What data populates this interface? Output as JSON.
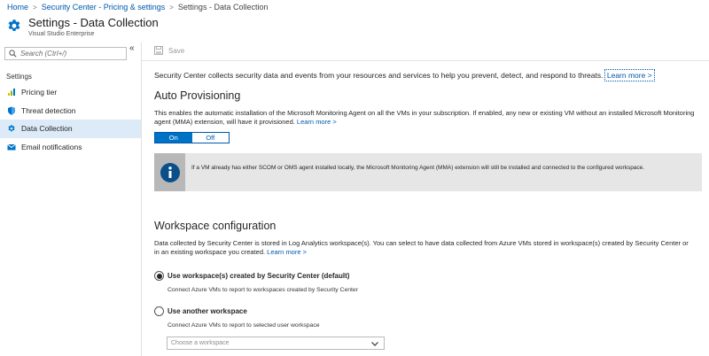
{
  "breadcrumb": {
    "items": [
      "Home",
      "Security Center - Pricing & settings",
      "Settings - Data Collection"
    ]
  },
  "header": {
    "title": "Settings - Data Collection",
    "subtitle": "Visual Studio Enterprise",
    "icon": "gear-icon",
    "icon_color": "#0072c6"
  },
  "sidebar": {
    "collapse_label": "«",
    "search": {
      "placeholder": "Search (Ctrl+/)",
      "value": ""
    },
    "section_label": "Settings",
    "items": [
      {
        "label": "Pricing tier",
        "icon": "pricing-tier-icon",
        "active": false
      },
      {
        "label": "Threat detection",
        "icon": "shield-icon",
        "active": false
      },
      {
        "label": "Data Collection",
        "icon": "gear-icon",
        "active": true
      },
      {
        "label": "Email notifications",
        "icon": "email-icon",
        "active": false
      }
    ]
  },
  "toolbar": {
    "save_label": "Save",
    "save_enabled": false
  },
  "intro": {
    "text": "Security Center collects security data and events from your resources and services to help you prevent, detect, and respond to threats.",
    "link": "Learn more >"
  },
  "auto_provisioning": {
    "title": "Auto Provisioning",
    "description": "This enables the automatic installation of the Microsoft Monitoring Agent on all the VMs in your subscription. If enabled, any new or existing VM without an installed Microsoft Monitoring agent (MMA) extension, will have it provisioned.",
    "link": "Learn more >",
    "toggle": {
      "on_label": "On",
      "off_label": "Off",
      "selected": "On"
    },
    "info_text": "If a VM already has either SCOM or OMS agent installed locally, the Microsoft Monitoring Agent (MMA) extension will still be installed and connected to the configured workspace."
  },
  "workspace": {
    "title": "Workspace configuration",
    "description": "Data collected by Security Center is stored in Log Analytics workspace(s). You can select to have data collected from Azure VMs stored in workspace(s) created by Security Center or in an existing workspace you created.",
    "link": "Learn more >",
    "options": [
      {
        "label": "Use workspace(s) created by Security Center (default)",
        "description": "Connect Azure VMs to report to workspaces created by Security Center",
        "selected": true
      },
      {
        "label": "Use another workspace",
        "description": "Connect Azure VMs to report to selected user workspace",
        "selected": false
      }
    ],
    "select_placeholder": "Choose a workspace"
  },
  "colors": {
    "accent": "#0072c6",
    "link": "#0058ad",
    "active_nav": "#dcebf7",
    "info_bg": "#e6e6e6",
    "info_side": "#b8b8b8"
  }
}
